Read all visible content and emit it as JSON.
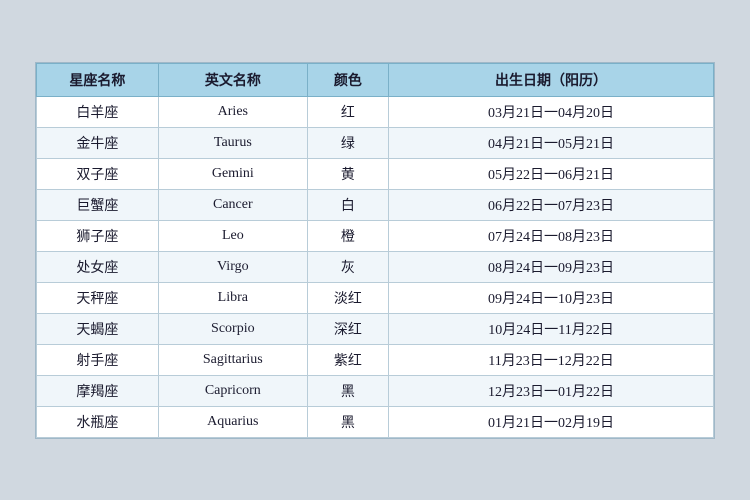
{
  "table": {
    "headers": [
      "星座名称",
      "英文名称",
      "颜色",
      "出生日期（阳历）"
    ],
    "rows": [
      {
        "zh": "白羊座",
        "en": "Aries",
        "color": "红",
        "date": "03月21日一04月20日"
      },
      {
        "zh": "金牛座",
        "en": "Taurus",
        "color": "绿",
        "date": "04月21日一05月21日"
      },
      {
        "zh": "双子座",
        "en": "Gemini",
        "color": "黄",
        "date": "05月22日一06月21日"
      },
      {
        "zh": "巨蟹座",
        "en": "Cancer",
        "color": "白",
        "date": "06月22日一07月23日"
      },
      {
        "zh": "狮子座",
        "en": "Leo",
        "color": "橙",
        "date": "07月24日一08月23日"
      },
      {
        "zh": "处女座",
        "en": "Virgo",
        "color": "灰",
        "date": "08月24日一09月23日"
      },
      {
        "zh": "天秤座",
        "en": "Libra",
        "color": "淡红",
        "date": "09月24日一10月23日"
      },
      {
        "zh": "天蝎座",
        "en": "Scorpio",
        "color": "深红",
        "date": "10月24日一11月22日"
      },
      {
        "zh": "射手座",
        "en": "Sagittarius",
        "color": "紫红",
        "date": "11月23日一12月22日"
      },
      {
        "zh": "摩羯座",
        "en": "Capricorn",
        "color": "黑",
        "date": "12月23日一01月22日"
      },
      {
        "zh": "水瓶座",
        "en": "Aquarius",
        "color": "黑",
        "date": "01月21日一02月19日"
      }
    ]
  }
}
